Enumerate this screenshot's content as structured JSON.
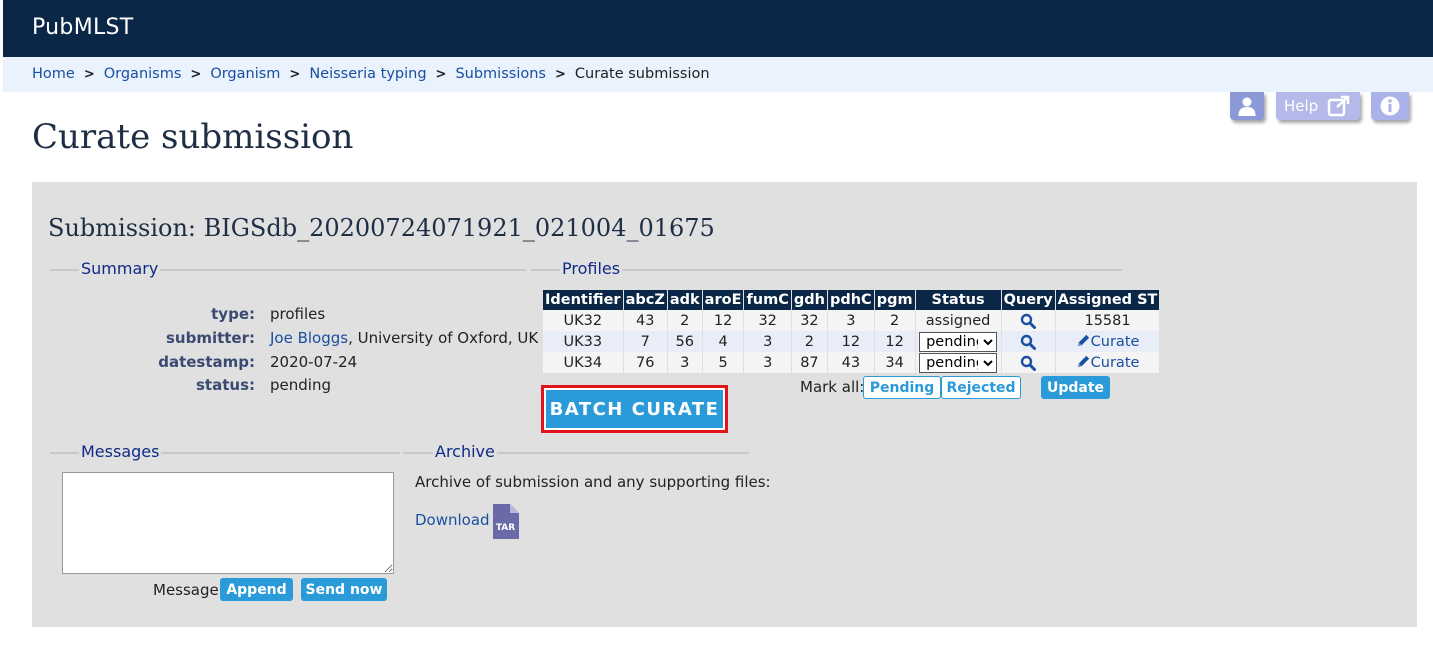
{
  "header": {
    "brand": "PubMLST"
  },
  "breadcrumbs": {
    "items": [
      "Home",
      "Organisms",
      "Organism",
      "Neisseria typing",
      "Submissions"
    ],
    "current": "Curate submission",
    "separator": ">"
  },
  "toolbar": {
    "help_label": "Help"
  },
  "page": {
    "title": "Curate submission"
  },
  "submission": {
    "title": "Submission: BIGSdb_20200724071921_021004_01675",
    "summary_legend": "Summary",
    "summary": {
      "type_key": "type:",
      "type_val": "profiles",
      "submitter_key": "submitter:",
      "submitter_name": "Joe Bloggs",
      "submitter_affil": ", University of Oxford, UK",
      "datestamp_key": "datestamp:",
      "datestamp_val": "2020-07-24",
      "status_key": "status:",
      "status_val": "pending"
    },
    "profiles_legend": "Profiles",
    "profiles": {
      "headers": [
        "Identifier",
        "abcZ",
        "adk",
        "aroE",
        "fumC",
        "gdh",
        "pdhC",
        "pgm",
        "Status",
        "Query",
        "Assigned ST"
      ],
      "rows": [
        {
          "id": "UK32",
          "abcZ": "43",
          "adk": "2",
          "aroE": "12",
          "fumC": "32",
          "gdh": "32",
          "pdhC": "3",
          "pgm": "2",
          "status": "assigned",
          "assigned": "15581"
        },
        {
          "id": "UK33",
          "abcZ": "7",
          "adk": "56",
          "aroE": "4",
          "fumC": "3",
          "gdh": "2",
          "pdhC": "12",
          "pgm": "12",
          "status": "pending",
          "assigned": "Curate"
        },
        {
          "id": "UK34",
          "abcZ": "76",
          "adk": "3",
          "aroE": "5",
          "fumC": "3",
          "gdh": "87",
          "pdhC": "43",
          "pgm": "34",
          "status": "pending",
          "assigned": "Curate"
        }
      ],
      "mark_all_label": "Mark all:",
      "pending_button": "Pending",
      "rejected_button": "Rejected",
      "update_button": "Update"
    },
    "batch_curate_button": "BATCH CURATE",
    "messages_legend": "Messages",
    "message_label": "Message:",
    "append_button": "Append",
    "send_now_button": "Send now",
    "archive_legend": "Archive",
    "archive_text": "Archive of submission and any supporting files:",
    "download_link": "Download",
    "tar_icon_label": "TAR"
  },
  "colors": {
    "topbar": "#0b2747",
    "breadcrumb_bg": "#eaf2fd",
    "panel_bg": "#e0e0e0",
    "accent_button": "#2a9ad8",
    "highlight_border": "#e0141b",
    "link": "#1a4fa0"
  },
  "icons": [
    "user-icon",
    "external-link-icon",
    "info-icon",
    "search-icon",
    "pencil-icon",
    "tar-file-icon"
  ]
}
